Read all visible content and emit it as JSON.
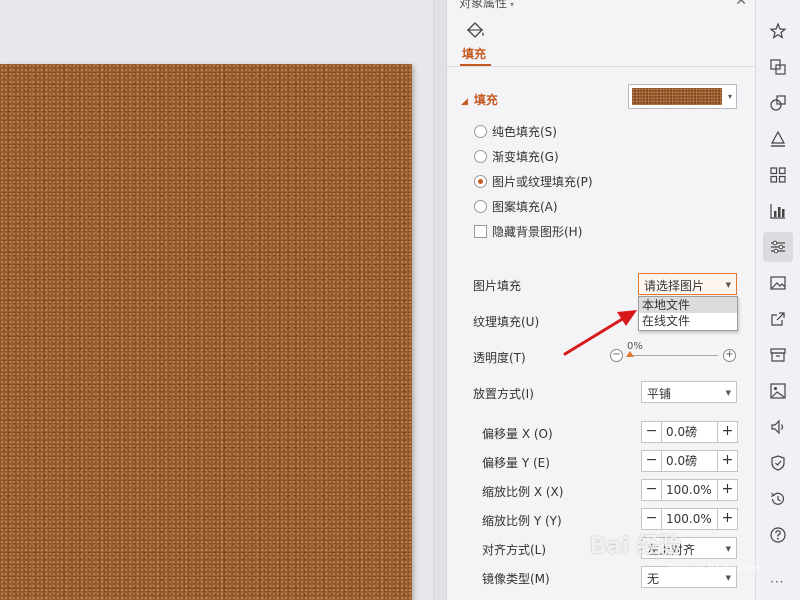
{
  "panel": {
    "title": "对象属性",
    "tab_label": "填充",
    "section_title": "填充",
    "fill_options": [
      {
        "label": "纯色填充(S)",
        "selected": false
      },
      {
        "label": "渐变填充(G)",
        "selected": false
      },
      {
        "label": "图片或纹理填充(P)",
        "selected": true
      },
      {
        "label": "图案填充(A)",
        "selected": false
      }
    ],
    "hide_bg_label": "隐藏背景图形(H)",
    "picture_fill_label": "图片填充",
    "picture_fill_value": "请选择图片",
    "picture_fill_menu": [
      "本地文件",
      "在线文件"
    ],
    "texture_fill_label": "纹理填充(U)",
    "transparency_label": "透明度(T)",
    "transparency_value": "0%",
    "placement_label": "放置方式(I)",
    "placement_value": "平铺",
    "offset_x_label": "偏移量 X (O)",
    "offset_x_value": "0.0磅",
    "offset_y_label": "偏移量 Y (E)",
    "offset_y_value": "0.0磅",
    "scale_x_label": "缩放比例 X (X)",
    "scale_x_value": "100.0%",
    "scale_y_label": "缩放比例 Y (Y)",
    "scale_y_value": "100.0%",
    "align_label": "对齐方式(L)",
    "align_value": "左上对齐",
    "mirror_label": "镜像类型(M)",
    "mirror_value": "无"
  },
  "toolbar": {
    "items": [
      "star-icon",
      "layers-icon",
      "shapes-icon",
      "text-fill-icon",
      "grid-icon",
      "chart-icon",
      "settings-sliders-icon",
      "image-icon",
      "share-icon",
      "archive-icon",
      "picture-icon",
      "audio-icon",
      "shield-icon",
      "history-icon",
      "help-icon"
    ],
    "active_index": 6,
    "more": "···"
  },
  "watermark": {
    "text": "Bai 经验",
    "sub": "jingyan.baidu.com"
  },
  "colors": {
    "accent": "#c55a21",
    "annotation": "#d7191c"
  }
}
